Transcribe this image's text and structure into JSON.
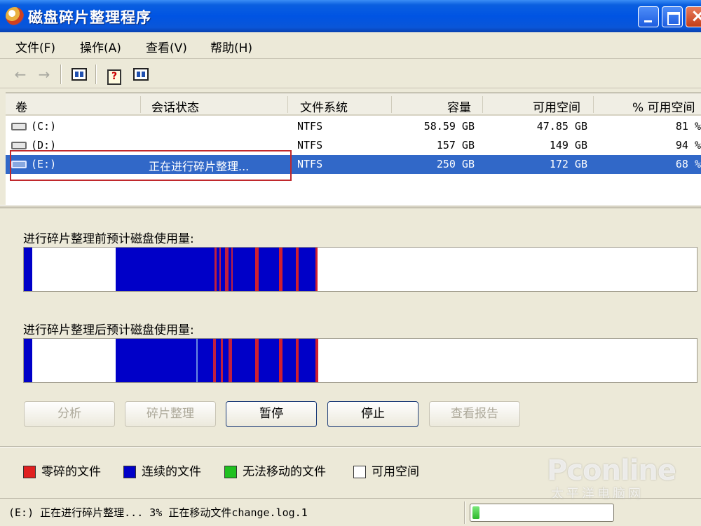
{
  "window": {
    "title": "磁盘碎片整理程序"
  },
  "menu": [
    {
      "label": "文件(F)"
    },
    {
      "label": "操作(A)"
    },
    {
      "label": "查看(V)"
    },
    {
      "label": "帮助(H)"
    }
  ],
  "toolbar": {
    "icons": [
      "back-arrow-icon",
      "forward-arrow-icon",
      "defrag-view-icon",
      "properties-help-icon",
      "show-hide-icon"
    ]
  },
  "columns": [
    "卷",
    "会话状态",
    "文件系统",
    "容量",
    "可用空间",
    "% 可用空间"
  ],
  "volumes": [
    {
      "volume": "(C:)",
      "status": "",
      "fs": "NTFS",
      "capacity": "58.59 GB",
      "free": "47.85 GB",
      "pct": "81 %"
    },
    {
      "volume": "(D:)",
      "status": "",
      "fs": "NTFS",
      "capacity": "157 GB",
      "free": "149 GB",
      "pct": "94 %"
    },
    {
      "volume": "(E:)",
      "status": "正在进行碎片整理...",
      "fs": "NTFS",
      "capacity": "250 GB",
      "free": "172 GB",
      "pct": "68 %"
    }
  ],
  "usage": {
    "before_label": "进行碎片整理前预计磁盘使用量:",
    "after_label": "进行碎片整理后预计磁盘使用量:"
  },
  "buttons": [
    {
      "label": "分析",
      "enabled": false
    },
    {
      "label": "碎片整理",
      "enabled": false
    },
    {
      "label": "暂停",
      "enabled": true
    },
    {
      "label": "停止",
      "enabled": true
    },
    {
      "label": "查看报告",
      "enabled": false
    }
  ],
  "legend": [
    {
      "label": "零碎的文件",
      "color": "#e02020"
    },
    {
      "label": "连续的文件",
      "color": "#0000c8"
    },
    {
      "label": "无法移动的文件",
      "color": "#20c020"
    },
    {
      "label": "可用空间",
      "color": "#ffffff"
    }
  ],
  "status": {
    "text": "(E:) 正在进行碎片整理... 3%  正在移动文件change.log.1",
    "progress": 0.03
  },
  "watermark": {
    "brand": "Pconline",
    "sub": "太平洋电脑网"
  },
  "colors": {
    "selection": "#3168c8",
    "contiguous": "#0000c8",
    "fragmented": "#e02020",
    "free": "#ffffff"
  }
}
